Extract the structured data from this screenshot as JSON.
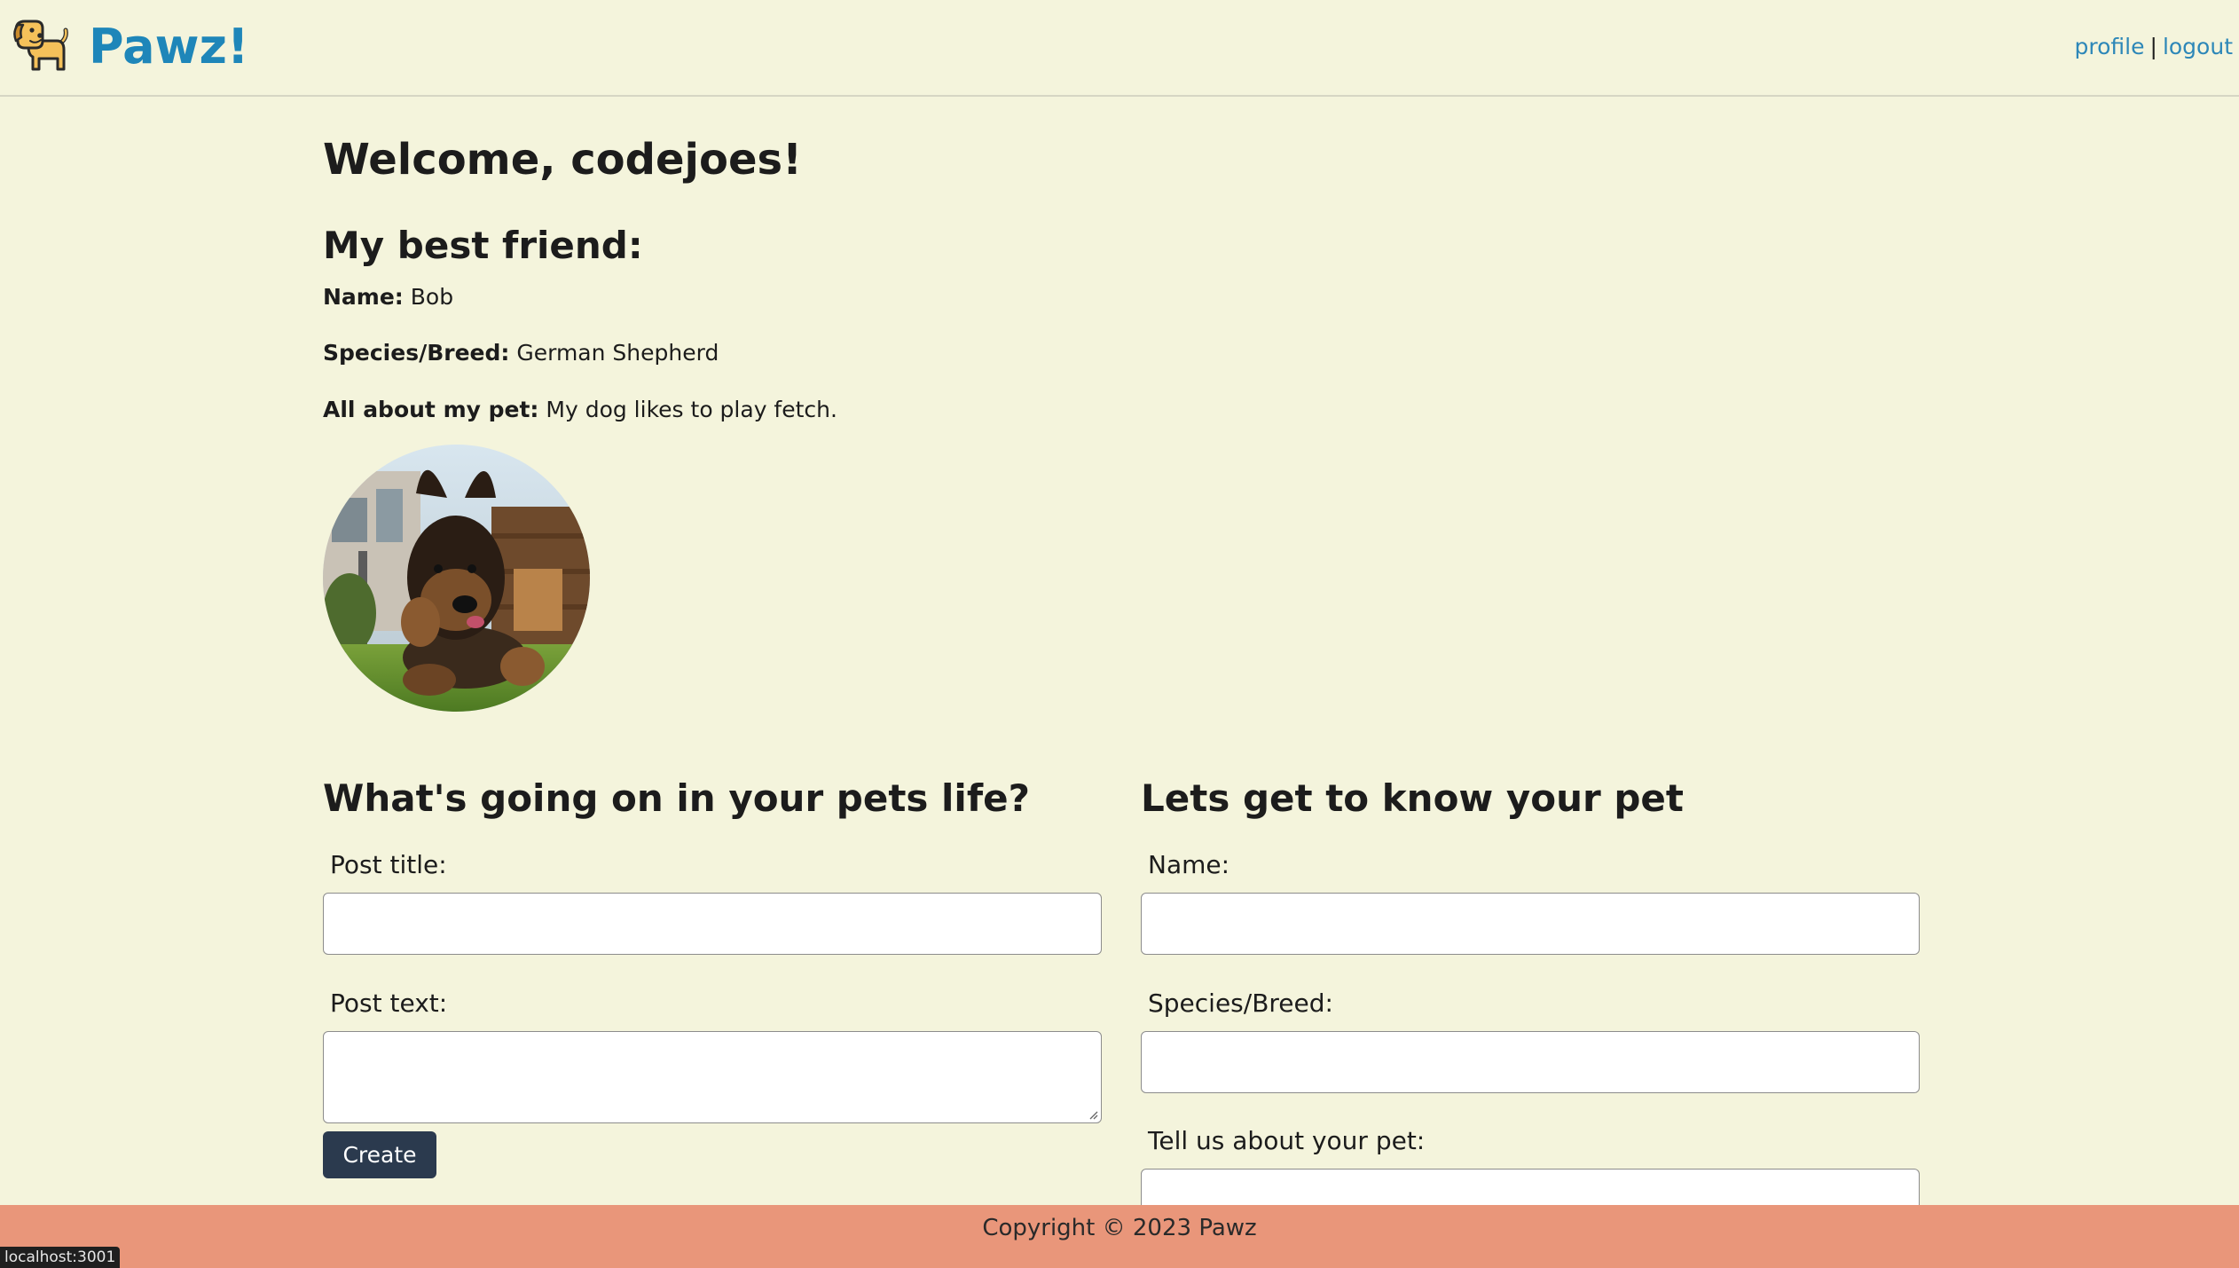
{
  "header": {
    "brand_name": "Pawz!",
    "logo_icon": "dog-icon",
    "nav": {
      "profile": "profile",
      "separator": "|",
      "logout": "logout"
    }
  },
  "main": {
    "welcome": "Welcome, codejoes!",
    "friend_heading": "My best friend:",
    "pet": {
      "name_label": "Name:",
      "name_value": "Bob",
      "species_label": "Species/Breed:",
      "species_value": "German Shepherd",
      "about_label": "All about my pet:",
      "about_value": "My dog likes to play fetch."
    }
  },
  "post_form": {
    "heading": "What's going on in your pets life?",
    "title_label": "Post title:",
    "title_value": "",
    "text_label": "Post text:",
    "text_value": "",
    "create_label": "Create"
  },
  "pet_form": {
    "heading": "Lets get to know your pet",
    "name_label": "Name:",
    "name_value": "",
    "species_label": "Species/Breed:",
    "species_value": "",
    "about_label": "Tell us about your pet:",
    "about_value": ""
  },
  "footer": {
    "copyright": "Copyright © 2023 Pawz"
  },
  "status_bar": {
    "url": "localhost:3001"
  },
  "colors": {
    "background": "#f4f4dc",
    "brand": "#1e86b9",
    "link": "#2d87b8",
    "button": "#2b3a4e",
    "footer": "#e9967a"
  }
}
